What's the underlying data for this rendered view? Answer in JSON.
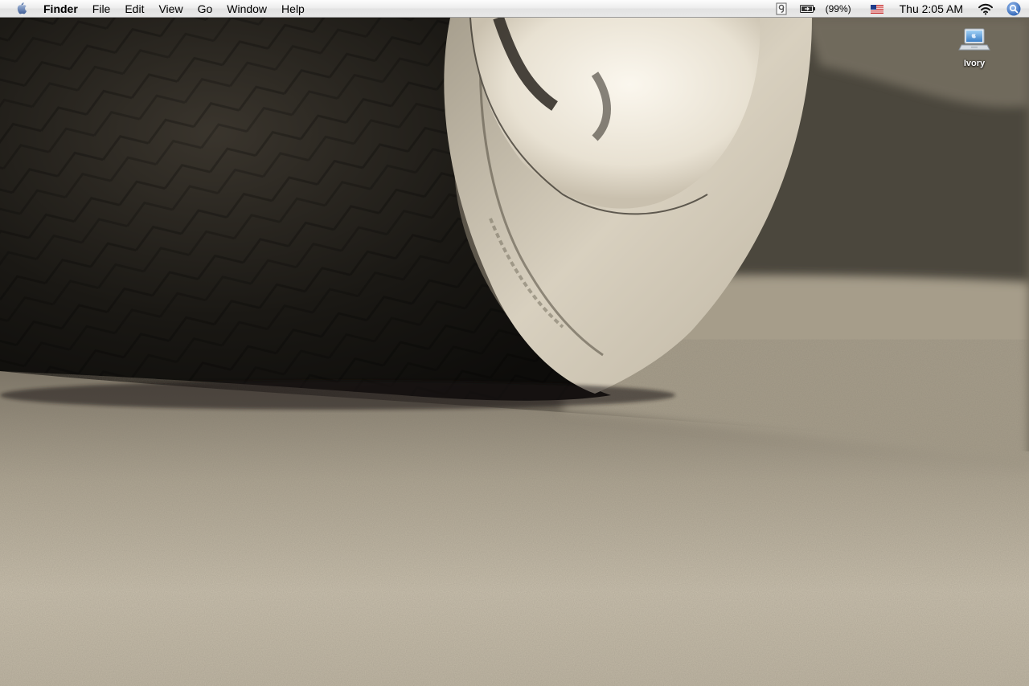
{
  "menubar": {
    "app_name": "Finder",
    "items": [
      "File",
      "Edit",
      "View",
      "Go",
      "Window",
      "Help"
    ],
    "battery_percent": "(99%)",
    "clock": "Thu 2:05 AM"
  },
  "desktop": {
    "icons": [
      {
        "label": "Ivory",
        "icon": "laptop-icon"
      }
    ]
  },
  "colors": {
    "menubar_bg": "#ececec",
    "wallpaper_tone": "#8f8574"
  }
}
